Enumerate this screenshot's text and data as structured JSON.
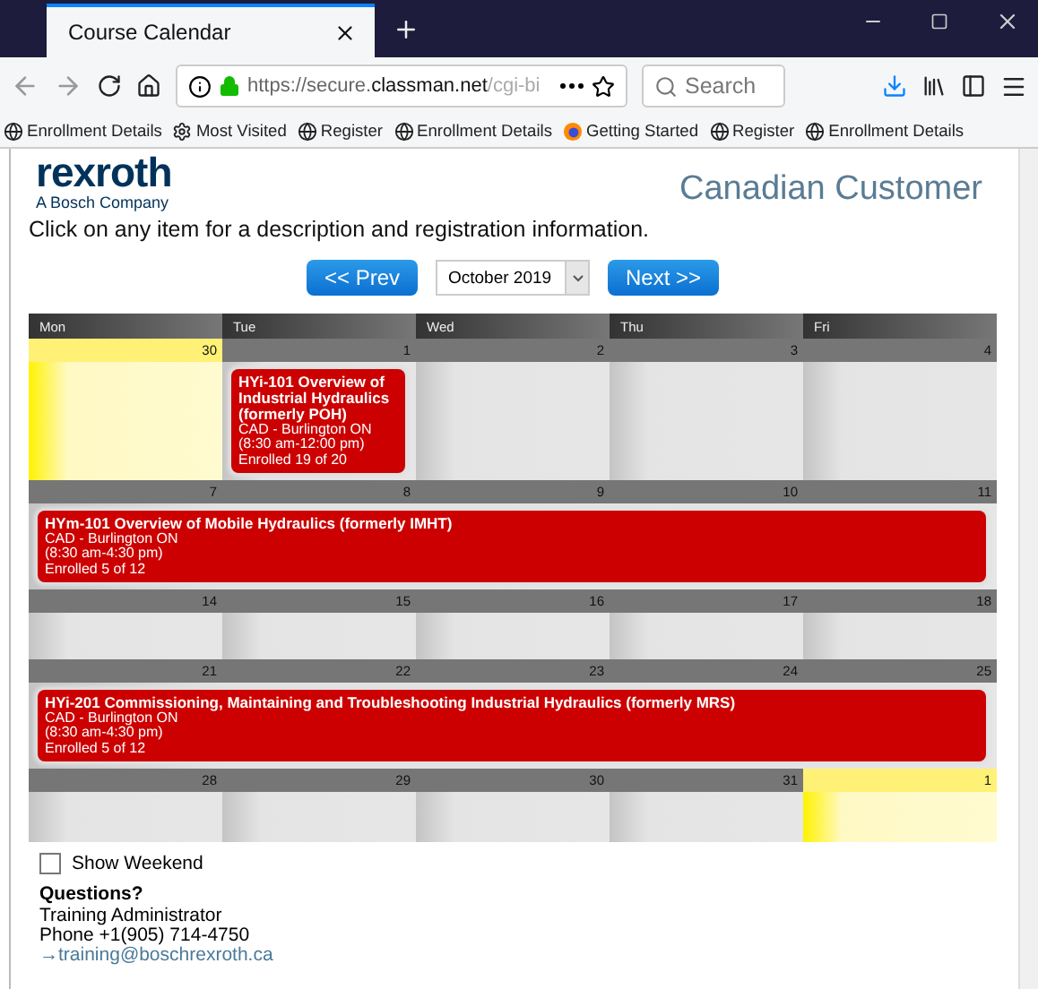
{
  "browser": {
    "tab": {
      "title": "Course Calendar",
      "selected": true
    },
    "url": {
      "host_prefix": "https://secure.",
      "host": "classman.net",
      "path": "/cgi-bi"
    },
    "search": {
      "placeholder": "Search"
    },
    "bookmarks": [
      {
        "label": "Enrollment Details",
        "kind": "globe"
      },
      {
        "label": "Most Visited",
        "kind": "gear"
      },
      {
        "label": "Register",
        "kind": "globe"
      },
      {
        "label": "Enrollment Details",
        "kind": "globe"
      },
      {
        "label": "Getting Started",
        "kind": "fox"
      },
      {
        "label": "Register",
        "kind": "globe"
      },
      {
        "label": "Enrollment Details",
        "kind": "globe"
      }
    ]
  },
  "page": {
    "logo": {
      "name": "rexroth",
      "tagline": "A Bosch Company"
    },
    "heading": "Canadian Customer",
    "instructions": "Click on any item for a description and registration information.",
    "nav": {
      "prev": "<< Prev",
      "month": "October 2019",
      "next": "Next >>"
    },
    "calendar": {
      "weekdays": [
        "Mon",
        "Tue",
        "Wed",
        "Thu",
        "Fri"
      ],
      "weeks": [
        {
          "days": [
            {
              "number": "30",
              "other_month": true,
              "covered": false
            },
            {
              "number": "1",
              "other_month": false,
              "covered": false,
              "event": {
                "title": "HYi-101 Overview of Industrial Hydraulics (formerly POH)",
                "location": "CAD - Burlington ON",
                "time": "(8:30 am-12:00 pm)",
                "enrolled": "Enrolled 19 of 20"
              }
            },
            {
              "number": "2",
              "other_month": false,
              "covered": false
            },
            {
              "number": "3",
              "other_month": false,
              "covered": false
            },
            {
              "number": "4",
              "other_month": false,
              "covered": false
            }
          ]
        },
        {
          "days": [
            {
              "number": "7",
              "other_month": false,
              "covered": false,
              "event": {
                "title": "HYm-101 Overview of Mobile Hydraulics (formerly IMHT)",
                "location": "CAD - Burlington ON",
                "time": "(8:30 am-4:30 pm)",
                "enrolled": "Enrolled 5 of 12"
              }
            },
            {
              "number": "8",
              "other_month": false,
              "covered": true
            },
            {
              "number": "9",
              "other_month": false,
              "covered": true
            },
            {
              "number": "10",
              "other_month": false,
              "covered": true
            },
            {
              "number": "11",
              "other_month": false,
              "covered": true
            }
          ]
        },
        {
          "days": [
            {
              "number": "14",
              "other_month": false,
              "covered": false
            },
            {
              "number": "15",
              "other_month": false,
              "covered": false
            },
            {
              "number": "16",
              "other_month": false,
              "covered": false
            },
            {
              "number": "17",
              "other_month": false,
              "covered": false
            },
            {
              "number": "18",
              "other_month": false,
              "covered": false
            }
          ]
        },
        {
          "days": [
            {
              "number": "21",
              "other_month": false,
              "covered": false,
              "event": {
                "title": "HYi-201 Commissioning, Maintaining and Troubleshooting Industrial Hydraulics (formerly MRS)",
                "location": "CAD - Burlington ON",
                "time": "(8:30 am-4:30 pm)",
                "enrolled": "Enrolled 5 of 12"
              }
            },
            {
              "number": "22",
              "other_month": false,
              "covered": true
            },
            {
              "number": "23",
              "other_month": false,
              "covered": true
            },
            {
              "number": "24",
              "other_month": false,
              "covered": true
            },
            {
              "number": "25",
              "other_month": false,
              "covered": true
            }
          ]
        },
        {
          "days": [
            {
              "number": "28",
              "other_month": false,
              "covered": false
            },
            {
              "number": "29",
              "other_month": false,
              "covered": false
            },
            {
              "number": "30",
              "other_month": false,
              "covered": false
            },
            {
              "number": "31",
              "other_month": false,
              "covered": false
            },
            {
              "number": "1",
              "other_month": true,
              "covered": false
            }
          ]
        }
      ]
    },
    "show_weekend": {
      "label": "Show Weekend",
      "checked": false
    },
    "contact": {
      "heading": "Questions?",
      "role": "Training Administrator",
      "phone": "Phone +1(905) 714-4750",
      "email_icon": "→",
      "email": "training@boschrexroth.ca"
    }
  }
}
